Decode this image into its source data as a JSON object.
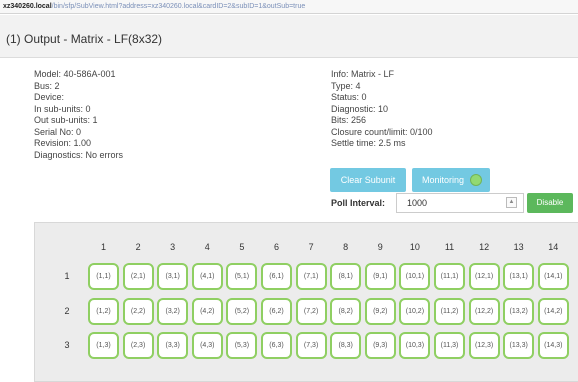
{
  "url": {
    "host": "xz340260.local",
    "path": "/bin/sfp/SubView.html?address=xz340260.local&cardID=2&subID=1&outSub=true"
  },
  "title": "(1) Output - Matrix - LF(8x32)",
  "left_info": [
    "Model: 40-586A-001",
    "Bus: 2",
    "Device:",
    "In sub-units: 0",
    "Out sub-units: 1",
    "Serial No: 0",
    "Revision: 1.00",
    "Diagnostics: No errors"
  ],
  "right_info": [
    "Info: Matrix - LF",
    "Type: 4",
    "Status: 0",
    "Diagnostic: 10",
    "Bits: 256",
    "Closure count/limit: 0/100",
    "Settle time: 2.5 ms"
  ],
  "buttons": {
    "clear_subunit": "Clear Subunit",
    "monitoring": "Monitoring",
    "disable": "Disable"
  },
  "poll": {
    "label": "Poll Interval:",
    "value": "1000"
  },
  "matrix": {
    "columns": [
      "1",
      "2",
      "3",
      "4",
      "5",
      "6",
      "7",
      "8",
      "9",
      "10",
      "11",
      "12",
      "13",
      "14"
    ],
    "rows": [
      "1",
      "2",
      "3"
    ],
    "cells": [
      [
        "(1,1)",
        "(2,1)",
        "(3,1)",
        "(4,1)",
        "(5,1)",
        "(6,1)",
        "(7,1)",
        "(8,1)",
        "(9,1)",
        "(10,1)",
        "(11,1)",
        "(12,1)",
        "(13,1)",
        "(14,1)"
      ],
      [
        "(1,2)",
        "(2,2)",
        "(3,2)",
        "(4,2)",
        "(5,2)",
        "(6,2)",
        "(7,2)",
        "(8,2)",
        "(9,2)",
        "(10,2)",
        "(11,2)",
        "(12,2)",
        "(13,2)",
        "(14,2)"
      ],
      [
        "(1,3)",
        "(2,3)",
        "(3,3)",
        "(4,3)",
        "(5,3)",
        "(6,3)",
        "(7,3)",
        "(8,3)",
        "(9,3)",
        "(10,3)",
        "(11,3)",
        "(12,3)",
        "(13,3)",
        "(14,3)"
      ]
    ]
  },
  "colors": {
    "cell_border": "#8fcf62",
    "info_button": "#5bc0de",
    "disable_button": "#5cb85c",
    "monitor_dot": "#7fd35a"
  }
}
